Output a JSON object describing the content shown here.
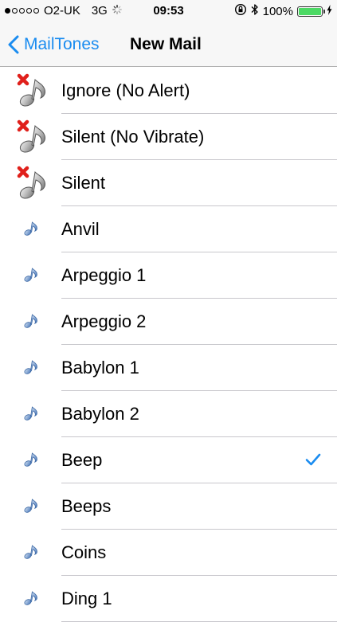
{
  "status_bar": {
    "carrier": "O2-UK",
    "network": "3G",
    "time": "09:53",
    "battery": "100%",
    "signal_bars_filled": 1,
    "signal_bars_total": 5
  },
  "nav": {
    "back_label": "MailTones",
    "title": "New Mail"
  },
  "colors": {
    "accent": "#1a8cf0",
    "battery_fill": "#4cd964",
    "x_mark": "#e0201b"
  },
  "tones": [
    {
      "label": "Ignore (No Alert)",
      "icon": "muted-note-icon",
      "selected": false
    },
    {
      "label": "Silent (No Vibrate)",
      "icon": "muted-note-icon",
      "selected": false
    },
    {
      "label": "Silent",
      "icon": "muted-note-icon",
      "selected": false
    },
    {
      "label": "Anvil",
      "icon": "music-note-icon",
      "selected": false
    },
    {
      "label": "Arpeggio 1",
      "icon": "music-note-icon",
      "selected": false
    },
    {
      "label": "Arpeggio 2",
      "icon": "music-note-icon",
      "selected": false
    },
    {
      "label": "Babylon 1",
      "icon": "music-note-icon",
      "selected": false
    },
    {
      "label": "Babylon 2",
      "icon": "music-note-icon",
      "selected": false
    },
    {
      "label": "Beep",
      "icon": "music-note-icon",
      "selected": true
    },
    {
      "label": "Beeps",
      "icon": "music-note-icon",
      "selected": false
    },
    {
      "label": "Coins",
      "icon": "music-note-icon",
      "selected": false
    },
    {
      "label": "Ding 1",
      "icon": "music-note-icon",
      "selected": false
    }
  ]
}
